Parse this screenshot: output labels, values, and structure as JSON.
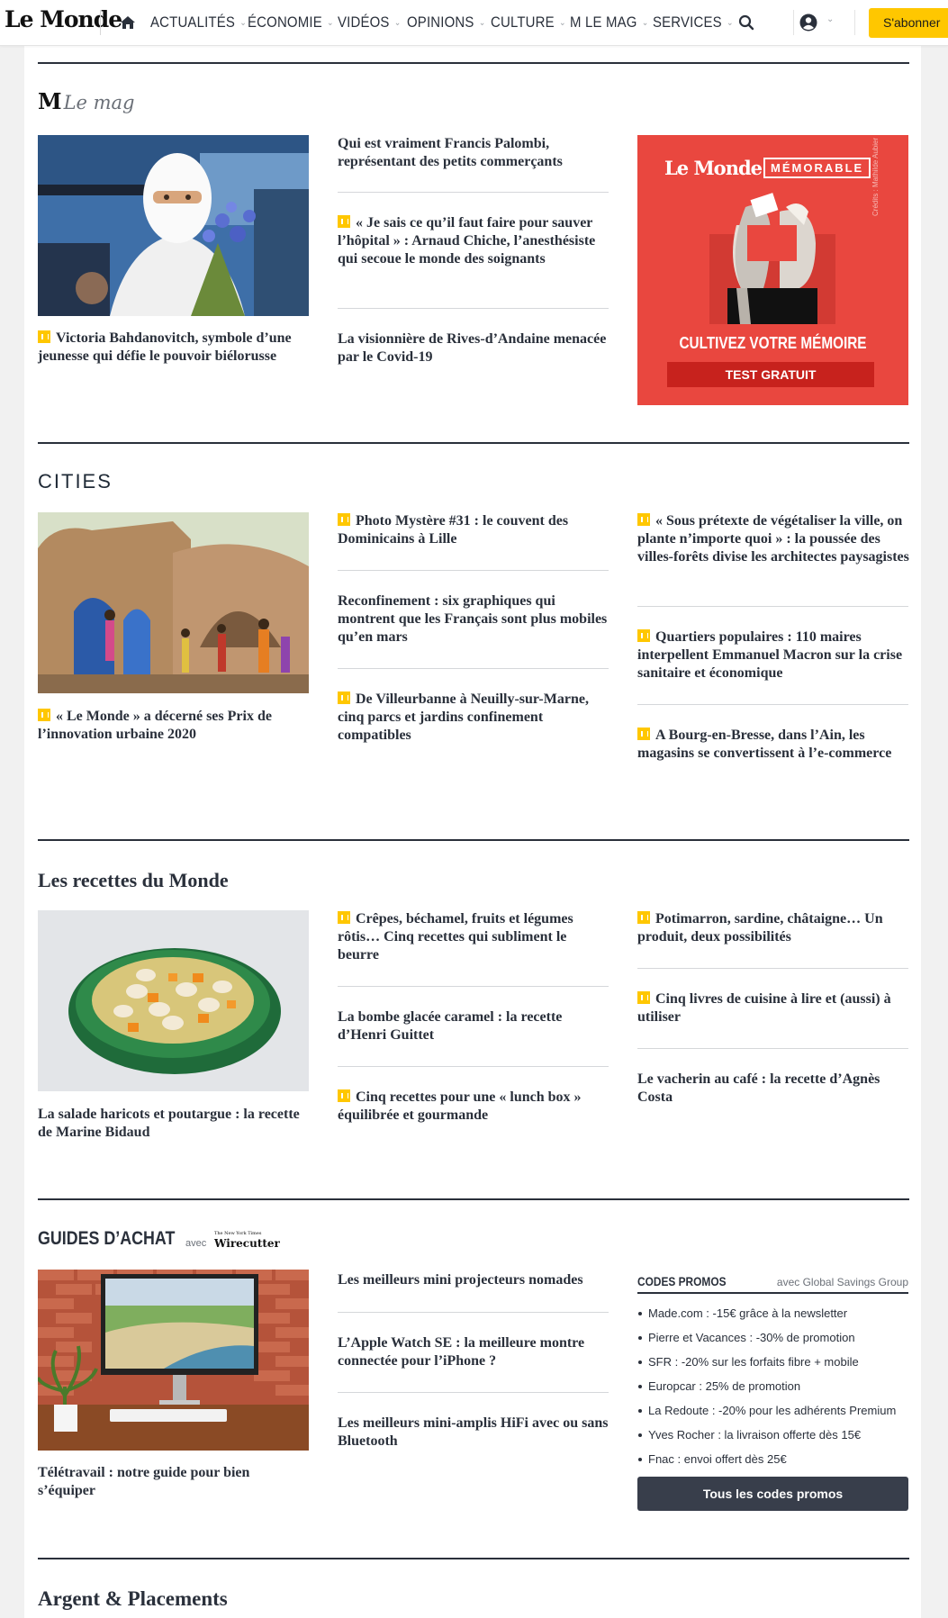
{
  "header": {
    "logo": "Le Monde",
    "nav": [
      {
        "label": "ACTUALITÉS",
        "has_menu": true
      },
      {
        "label": "ÉCONOMIE",
        "has_menu": true
      },
      {
        "label": "VIDÉOS",
        "has_menu": true
      },
      {
        "label": "OPINIONS",
        "has_menu": true
      },
      {
        "label": "CULTURE",
        "has_menu": true
      },
      {
        "label": "M LE MAG",
        "has_menu": true
      },
      {
        "label": "SERVICES",
        "has_menu": true
      }
    ],
    "subscribe_label": "S'abonner",
    "accent_color": "#ffc700"
  },
  "mag": {
    "title_m": "M",
    "title_rest": "Le mag",
    "lead": {
      "title": "Victoria Bahdanovitch, symbole d’une jeunesse qui défie le pouvoir biélorusse",
      "premium": true
    },
    "col2": [
      {
        "title": "Qui est vraiment Francis Palombi, représentant des petits commerçants",
        "premium": false
      },
      {
        "title": "« Je sais ce qu’il faut faire pour sauver l’hôpital » : Arnaud Chiche, l’anesthésiste qui secoue le monde des soignants",
        "premium": true
      },
      {
        "title": "La visionnière de Rives-d’Andaine menacée par le Covid-19",
        "premium": false
      }
    ],
    "ad": {
      "brand": "Le Monde",
      "tag": "MÉMORABLE",
      "headline": "CULTIVEZ VOTRE MÉMOIRE",
      "cta": "TEST GRATUIT",
      "credit": "Crédits : Mathilde Aubier",
      "color": "#e9473f"
    }
  },
  "cities": {
    "title": "CITIES",
    "lead": {
      "title": "« Le Monde » a décerné ses Prix de l’innovation urbaine 2020",
      "premium": true
    },
    "col2": [
      {
        "title": "Photo Mystère #31 : le couvent des Dominicains à Lille",
        "premium": true
      },
      {
        "title": "Reconfinement : six graphiques qui montrent que les Français sont plus mobiles qu’en mars",
        "premium": false
      },
      {
        "title": "De Villeurbanne à Neuilly-sur-Marne, cinq parcs et jardins confinement compatibles",
        "premium": true
      }
    ],
    "col3": [
      {
        "title": "« Sous prétexte de végétaliser la ville, on plante n’importe quoi » : la poussée des villes-forêts divise les architectes paysagistes",
        "premium": true
      },
      {
        "title": "Quartiers populaires : 110 maires interpellent Emmanuel Macron sur la crise sanitaire et économique",
        "premium": true
      },
      {
        "title": "A Bourg-en-Bresse, dans l’Ain, les magasins se convertissent à l’e-commerce",
        "premium": true
      }
    ]
  },
  "recettes": {
    "title": "Les recettes du Monde",
    "lead": {
      "title": "La salade haricots et poutargue : la recette de Marine Bidaud",
      "premium": false
    },
    "col2": [
      {
        "title": "Crêpes, béchamel, fruits et légumes rôtis… Cinq recettes qui subliment le beurre",
        "premium": true
      },
      {
        "title": "La bombe glacée caramel : la recette d’Henri Guittet",
        "premium": false
      },
      {
        "title": "Cinq recettes pour une « lunch box » équilibrée et gourmande",
        "premium": true
      }
    ],
    "col3": [
      {
        "title": "Potimarron, sardine, châtaigne… Un produit, deux possibilités",
        "premium": true
      },
      {
        "title": "Cinq livres de cuisine à lire et (aussi) à utiliser",
        "premium": true
      },
      {
        "title": "Le vacherin au café : la recette d’Agnès Costa",
        "premium": false
      }
    ]
  },
  "guides": {
    "title": "GUIDES D’ACHAT",
    "with": "avec",
    "partner_small": "The New York Times",
    "partner": "Wirecutter",
    "lead": {
      "title": "Télétravail : notre guide pour bien s’équiper",
      "premium": false
    },
    "col2": [
      {
        "title": "Les meilleurs mini projecteurs nomades",
        "premium": false
      },
      {
        "title": "L’Apple Watch SE : la meilleure montre connectée pour l’iPhone ?",
        "premium": false
      },
      {
        "title": "Les meilleurs mini-amplis HiFi avec ou sans Bluetooth",
        "premium": false
      }
    ],
    "promos": {
      "title": "CODES PROMOS",
      "partner": "avec Global Savings Group",
      "items": [
        "Made.com : -15€ grâce à la newsletter",
        "Pierre et Vacances : -30% de promotion",
        "SFR : -20% sur les forfaits fibre + mobile",
        "Europcar : 25% de promotion",
        "La Redoute : -20% pour les adhérents Premium",
        "Yves Rocher : la livraison offerte dès 15€",
        "Fnac : envoi offert dès 25€"
      ],
      "button": "Tous les codes promos"
    }
  },
  "argent": {
    "title": "Argent & Placements"
  }
}
